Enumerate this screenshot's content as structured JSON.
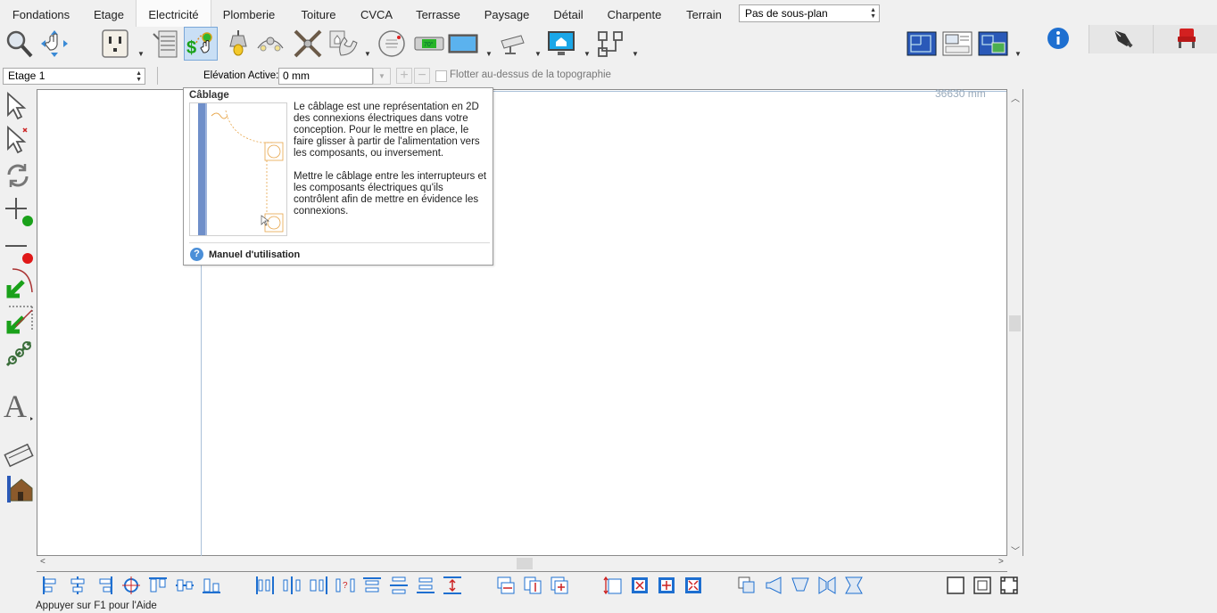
{
  "menu": {
    "tabs": [
      {
        "label": "Fondations"
      },
      {
        "label": "Etage"
      },
      {
        "label": "Electricité"
      },
      {
        "label": "Plomberie"
      },
      {
        "label": "Toiture"
      },
      {
        "label": "CVCA"
      },
      {
        "label": "Terrasse"
      },
      {
        "label": "Paysage"
      },
      {
        "label": "Détail"
      },
      {
        "label": "Charpente"
      },
      {
        "label": "Terrain"
      }
    ],
    "active_tab": "Electricité",
    "subplan_select": "Pas de sous-plan"
  },
  "toolbar": {
    "icons": [
      "zoom-icon",
      "pan-icon",
      "outlet-icon",
      "electrical-panel-icon",
      "wiring-icon",
      "ceiling-light-icon",
      "ceiling-fan-light-icon",
      "ceiling-fan-icon",
      "intercom-phone-icon",
      "smoke-detector-icon",
      "thermostat-icon",
      "tv-icon",
      "security-camera-icon",
      "computer-network-icon",
      "wiring-route-icon"
    ],
    "right_icons": [
      "plan-view-icon",
      "layout-view-icon",
      "camera-view-icon"
    ]
  },
  "right_panel": {
    "tabs": [
      "info-icon",
      "pen-icon",
      "chair-icon"
    ]
  },
  "options": {
    "floor_select": "Etage 1",
    "elevation_label": "Elévation Active:",
    "elevation_value": "0 mm",
    "float_label": "Flotter au-dessus de la topographie"
  },
  "canvas": {
    "measure": "36630 mm"
  },
  "tooltip": {
    "title": "Câblage",
    "paragraph1": "Le câblage est une représentation en 2D des connexions électriques dans votre conception. Pour le mettre en place, le faire glisser à partir de l'alimentation vers les composants, ou inversement.",
    "paragraph2": "Mettre le câblage entre les interrupteurs et les composants électriques qu'ils contrôlent afin de mettre en évidence les connexions.",
    "help_link": "Manuel d'utilisation"
  },
  "status": {
    "text": "Appuyer sur F1 pour l'Aide"
  },
  "colors": {
    "accent": "#1e6fd0",
    "selection_green": "#1aa11a"
  }
}
